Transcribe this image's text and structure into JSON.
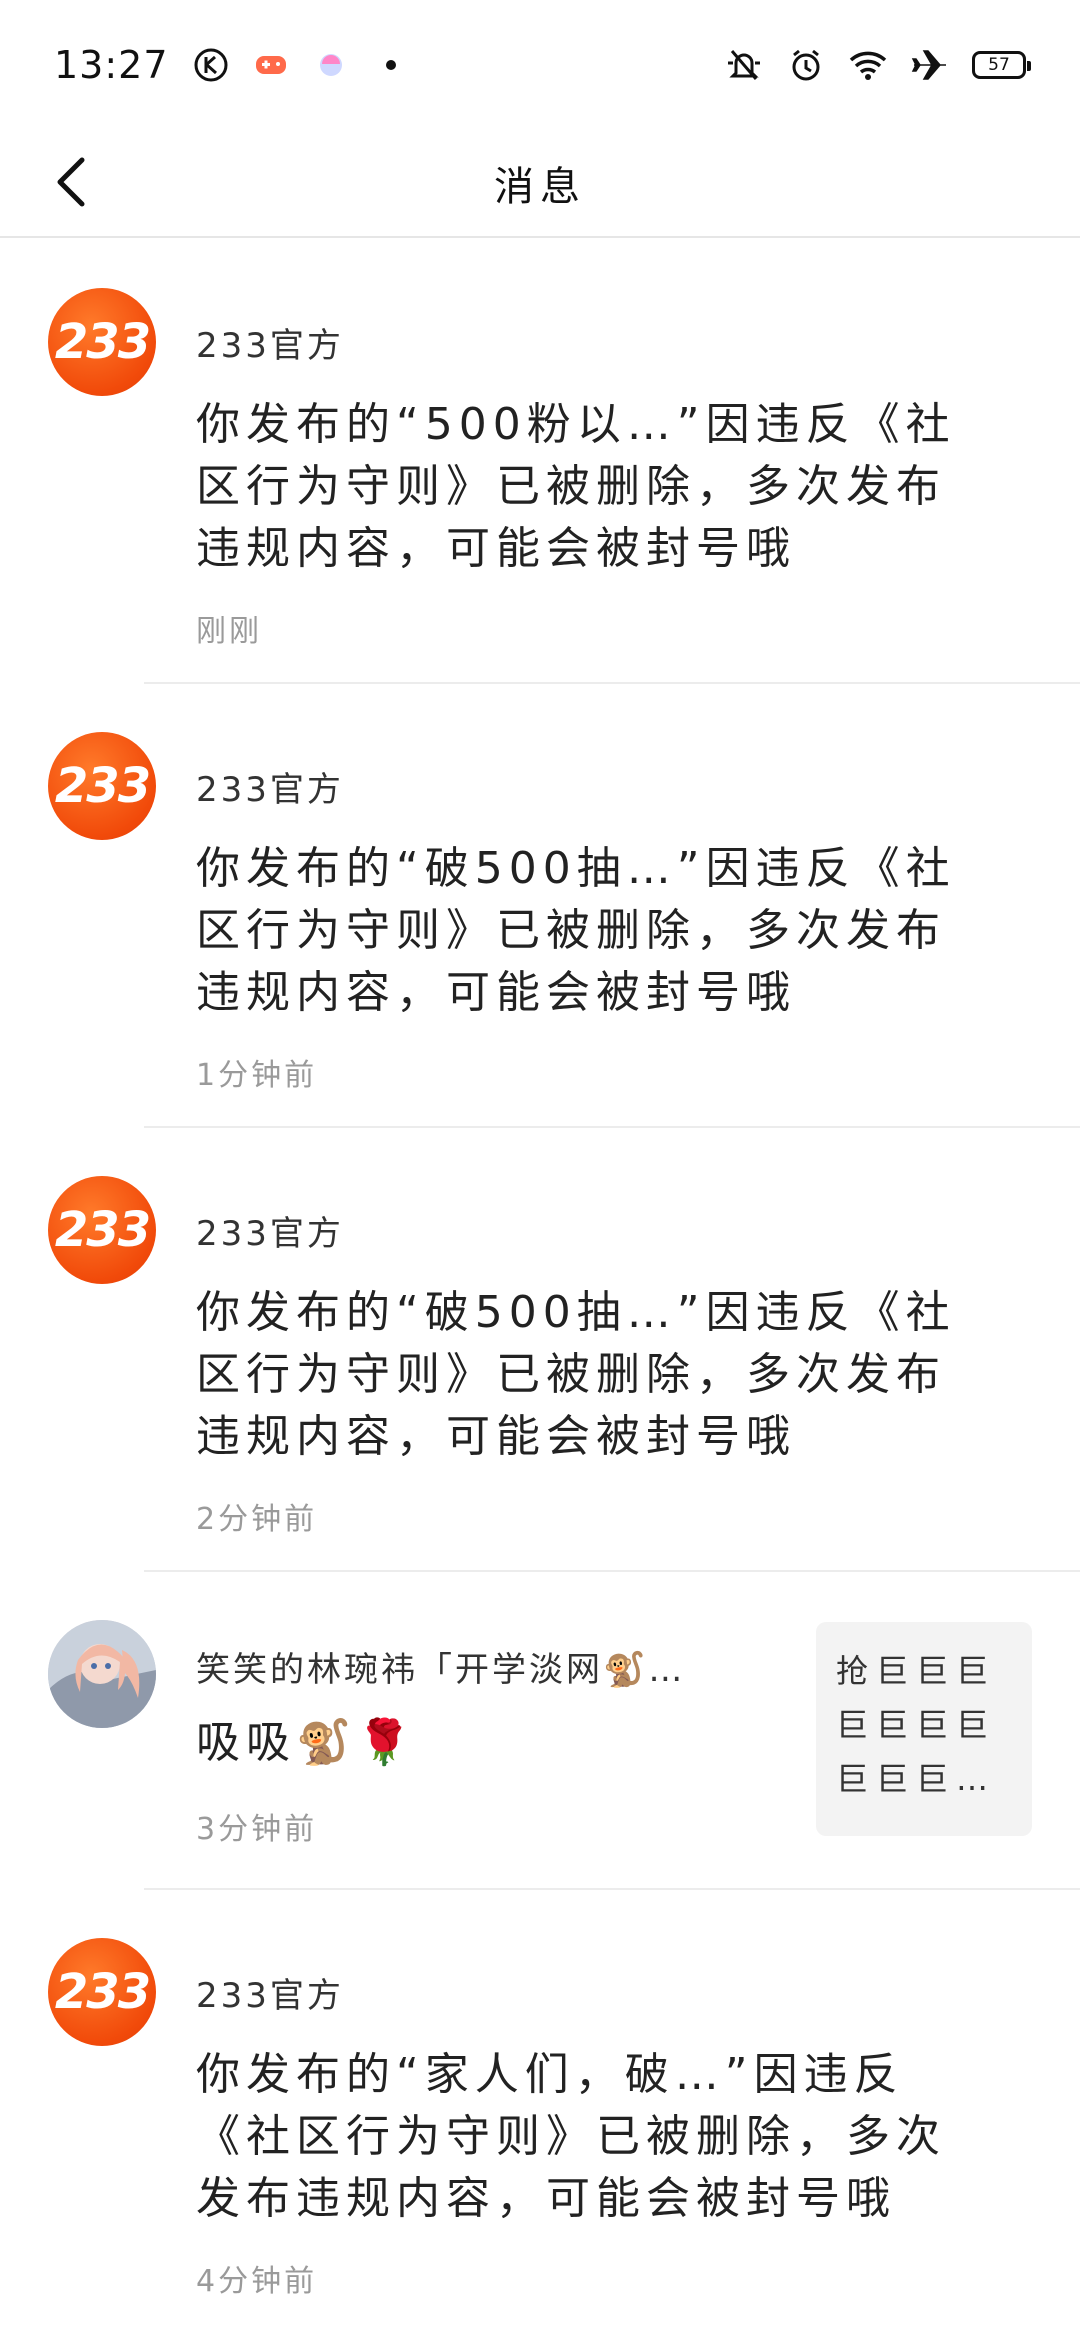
{
  "status_bar": {
    "time": "13:27",
    "battery": "57",
    "left_icons": [
      "k-app-icon",
      "game-controller-icon",
      "app-bubble-icon",
      "dot-icon"
    ],
    "right_icons": [
      "mute-bell-icon",
      "alarm-icon",
      "wifi-icon",
      "airplane-icon",
      "battery-icon"
    ]
  },
  "nav": {
    "title": "消息",
    "back_icon": "chevron-left-icon"
  },
  "messages": [
    {
      "sender": "233官方",
      "text": "你发布的“500粉以…”因违反《社区行为守则》已被删除，多次发布违规内容，可能会被封号哦",
      "time": "刚刚",
      "avatar": "233-logo"
    },
    {
      "sender": "233官方",
      "text": "你发布的“破500抽…”因违反《社区行为守则》已被删除，多次发布违规内容，可能会被封号哦",
      "time": "1分钟前",
      "avatar": "233-logo"
    },
    {
      "sender": "233官方",
      "text": "你发布的“破500抽…”因违反《社区行为守则》已被删除，多次发布违规内容，可能会被封号哦",
      "time": "2分钟前",
      "avatar": "233-logo"
    },
    {
      "sender": "笑笑的林琬祎「开学淡网🐒…",
      "text": "吸吸🐒🌹",
      "time": "3分钟前",
      "avatar": "user-avatar",
      "thumb_text": "抢巨巨巨巨巨巨巨巨巨巨…"
    },
    {
      "sender": "233官方",
      "text": "你发布的“家人们，破…”因违反《社区行为守则》已被删除，多次发布违规内容，可能会被封号哦",
      "time": "4分钟前",
      "avatar": "233-logo"
    }
  ],
  "logo_text": "233",
  "colors": {
    "accent": "#f14a0a",
    "divider": "#ececec",
    "time_gray": "#9a9a9a"
  }
}
